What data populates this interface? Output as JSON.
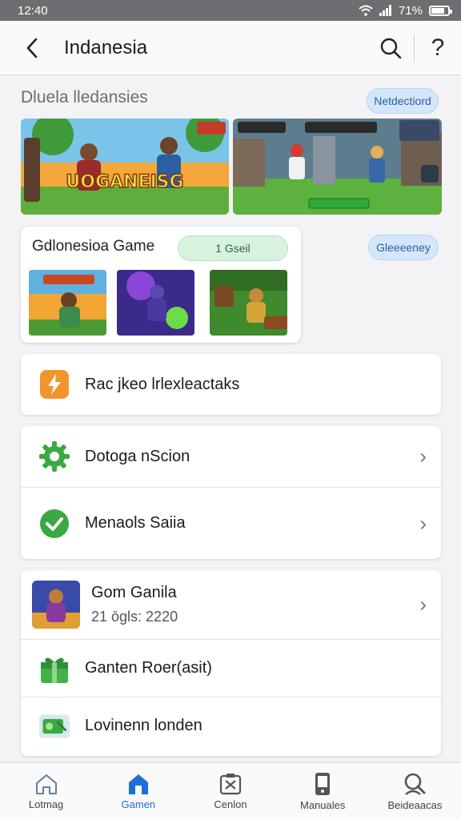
{
  "status_bar": {
    "time": "12:40",
    "battery_text": "71%",
    "battery_level": 0.71
  },
  "header": {
    "title": "Indanesia"
  },
  "section": {
    "title": "Dluela lledansies",
    "badge": "Netdectiord"
  },
  "banners": [
    {
      "overlay_text": "UOGANEISG"
    },
    {
      "overlay_text": ""
    }
  ],
  "game_card": {
    "title": "Gdlonesioa Game",
    "pill": "1 Gseil"
  },
  "side_pill": "Gleeeeney",
  "menu": {
    "item1": {
      "label": "Rac jkeo lrlexleactaks",
      "icon": "lightning-icon"
    },
    "item2": {
      "label": "Dotoga nScion",
      "icon": "gear-icon"
    },
    "item3": {
      "label": "Menaols Saiia",
      "icon": "check-icon"
    },
    "game": {
      "label": "Gom Ganila",
      "sub": "21 ōgls: 2220"
    },
    "item5": {
      "label": "Ganten Roer(asit)",
      "icon": "gift-icon"
    },
    "item6": {
      "label": "Lovinenn londen",
      "icon": "ticket-icon"
    }
  },
  "colors": {
    "accent": "#1e6ed8",
    "green": "#3aa843",
    "orange": "#f3942b"
  },
  "bottom_nav": [
    {
      "label": "Lotmag",
      "icon": "home-icon",
      "active": false
    },
    {
      "label": "Gamen",
      "icon": "store-icon",
      "active": true
    },
    {
      "label": "Cenlon",
      "icon": "box-icon",
      "active": false
    },
    {
      "label": "Manuales",
      "icon": "phone-icon",
      "active": false
    },
    {
      "label": "Beideaacas",
      "icon": "profile-icon",
      "active": false
    }
  ]
}
